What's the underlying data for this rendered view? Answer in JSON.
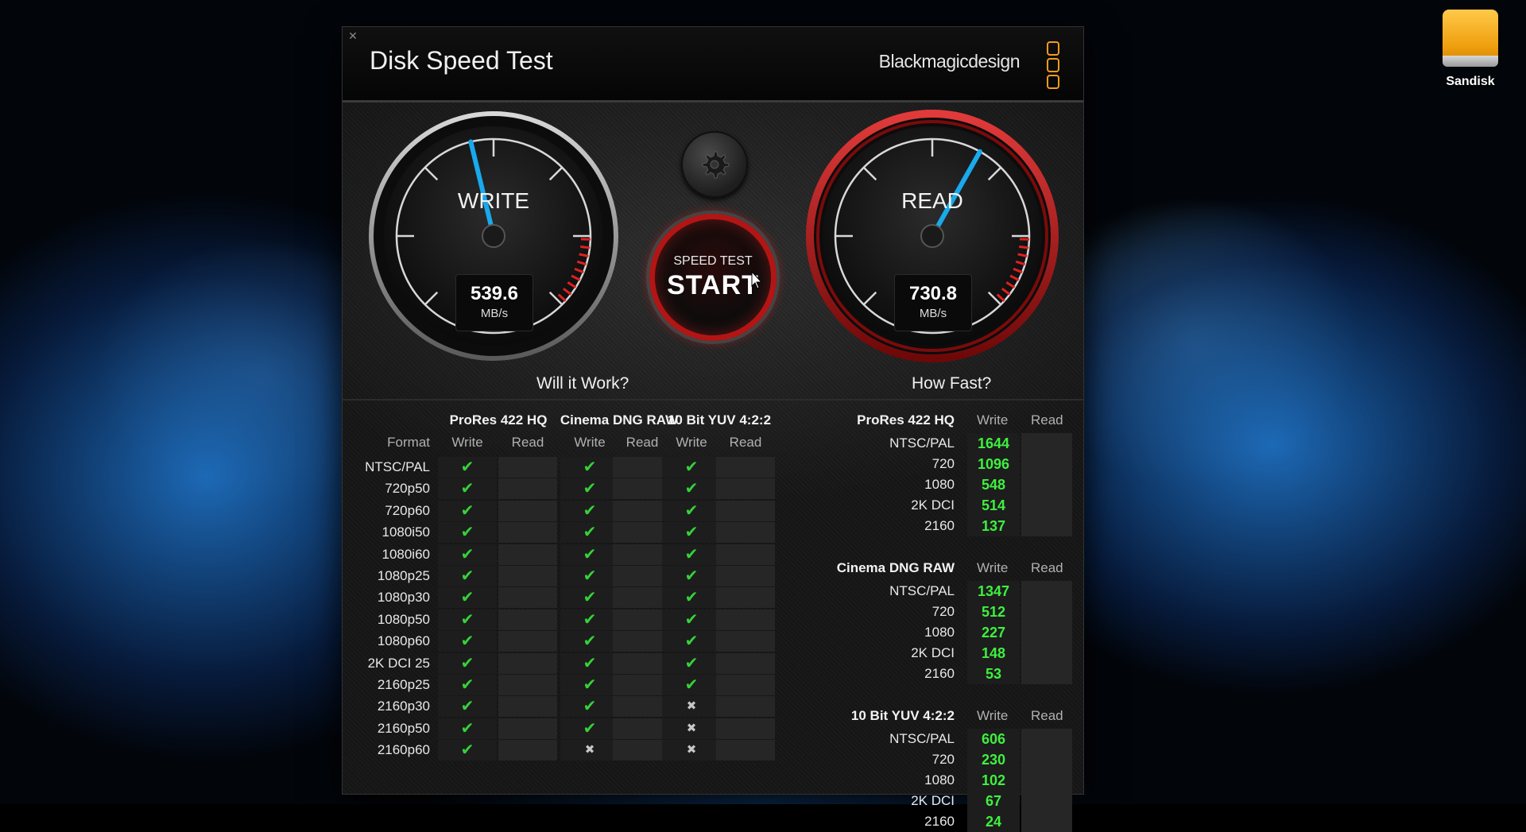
{
  "desktop": {
    "drive_label": "Sandisk"
  },
  "window": {
    "title": "Disk Speed Test",
    "brand": "Blackmagicdesign",
    "close_glyph": "✕"
  },
  "gauges": {
    "write": {
      "label": "WRITE",
      "value": "539.6",
      "unit": "MB/s",
      "needle_value": 539.6
    },
    "read": {
      "label": "READ",
      "value": "730.8",
      "unit": "MB/s",
      "needle_value": 730.8
    },
    "scale_max": 1200
  },
  "start_button": {
    "small": "SPEED TEST",
    "big": "START"
  },
  "will_it_work": {
    "title": "Will it Work?",
    "format_header": "Format",
    "groups": [
      "ProRes 422 HQ",
      "Cinema DNG RAW",
      "10 Bit YUV 4:2:2"
    ],
    "subheaders": [
      "Write",
      "Read"
    ],
    "rows": [
      {
        "format": "NTSC/PAL",
        "write": [
          true,
          true,
          true
        ]
      },
      {
        "format": "720p50",
        "write": [
          true,
          true,
          true
        ]
      },
      {
        "format": "720p60",
        "write": [
          true,
          true,
          true
        ]
      },
      {
        "format": "1080i50",
        "write": [
          true,
          true,
          true
        ]
      },
      {
        "format": "1080i60",
        "write": [
          true,
          true,
          true
        ]
      },
      {
        "format": "1080p25",
        "write": [
          true,
          true,
          true
        ]
      },
      {
        "format": "1080p30",
        "write": [
          true,
          true,
          true
        ]
      },
      {
        "format": "1080p50",
        "write": [
          true,
          true,
          true
        ]
      },
      {
        "format": "1080p60",
        "write": [
          true,
          true,
          true
        ]
      },
      {
        "format": "2K DCI 25",
        "write": [
          true,
          true,
          true
        ]
      },
      {
        "format": "2160p25",
        "write": [
          true,
          true,
          true
        ]
      },
      {
        "format": "2160p30",
        "write": [
          true,
          true,
          false
        ]
      },
      {
        "format": "2160p50",
        "write": [
          true,
          true,
          false
        ]
      },
      {
        "format": "2160p60",
        "write": [
          true,
          false,
          false
        ]
      }
    ]
  },
  "how_fast": {
    "title": "How Fast?",
    "write_header": "Write",
    "read_header": "Read",
    "groups": [
      {
        "name": "ProRes 422 HQ",
        "rows": [
          {
            "label": "NTSC/PAL",
            "write": "1644"
          },
          {
            "label": "720",
            "write": "1096"
          },
          {
            "label": "1080",
            "write": "548"
          },
          {
            "label": "2K DCI",
            "write": "514"
          },
          {
            "label": "2160",
            "write": "137"
          }
        ]
      },
      {
        "name": "Cinema DNG RAW",
        "rows": [
          {
            "label": "NTSC/PAL",
            "write": "1347"
          },
          {
            "label": "720",
            "write": "512"
          },
          {
            "label": "1080",
            "write": "227"
          },
          {
            "label": "2K DCI",
            "write": "148"
          },
          {
            "label": "2160",
            "write": "53"
          }
        ]
      },
      {
        "name": "10 Bit YUV 4:2:2",
        "rows": [
          {
            "label": "NTSC/PAL",
            "write": "606"
          },
          {
            "label": "720",
            "write": "230"
          },
          {
            "label": "1080",
            "write": "102"
          },
          {
            "label": "2K DCI",
            "write": "67"
          },
          {
            "label": "2160",
            "write": "24"
          }
        ]
      }
    ]
  },
  "colors": {
    "ok": "#36d13a",
    "fast_value": "#3ef03e",
    "brand_orange": "#f59b1b",
    "read_ring": "#b31515",
    "needle": "#19a9ec"
  },
  "icons": {
    "check": "✔",
    "cross": "✖",
    "settings": "gear-icon",
    "cursor": "cursor-arrow-icon"
  }
}
